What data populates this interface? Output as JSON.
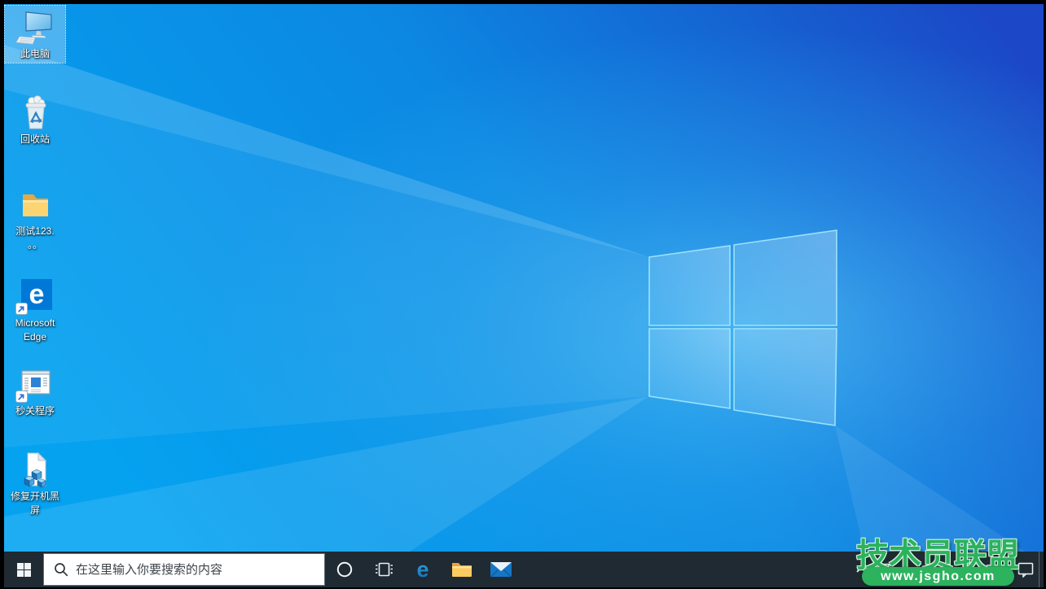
{
  "desktop": {
    "icons": [
      {
        "name": "this-pc",
        "icon": "computer-icon",
        "label": "此电脑",
        "selected": true
      },
      {
        "name": "recycle-bin",
        "icon": "recycle-bin-icon",
        "label": "回收站",
        "selected": false
      },
      {
        "name": "folder-test123",
        "icon": "folder-icon",
        "label": "测试123.",
        "label2": "。。",
        "selected": false
      },
      {
        "name": "microsoft-edge",
        "icon": "edge-tile-icon",
        "label": "Microsoft",
        "label2": "Edge",
        "shortcut": true,
        "selected": false
      },
      {
        "name": "seconds-close-program",
        "icon": "app-window-icon",
        "label": "秒关程序",
        "shortcut": true,
        "selected": false
      },
      {
        "name": "fix-boot-black-screen",
        "icon": "registry-file-icon",
        "label": "修复开机黑",
        "label2": "屏",
        "selected": false
      }
    ]
  },
  "taskbar": {
    "start": {
      "name": "start-button",
      "icon": "windows-logo-icon"
    },
    "search": {
      "placeholder": "在这里输入你要搜索的内容",
      "icon": "search-icon"
    },
    "buttons": [
      {
        "name": "cortana-button",
        "icon": "cortana-circle-icon"
      },
      {
        "name": "task-view-button",
        "icon": "task-view-icon"
      },
      {
        "name": "edge-button",
        "icon": "edge-e-icon"
      },
      {
        "name": "file-explorer-button",
        "icon": "folder-icon"
      },
      {
        "name": "mail-button",
        "icon": "mail-envelope-icon"
      }
    ],
    "tray": [
      {
        "name": "hidden-icons-button",
        "icon": "chevron-up-icon"
      },
      {
        "name": "network-button",
        "icon": "monitor-icon"
      },
      {
        "name": "ime-indicator",
        "icon": "ime-icon"
      },
      {
        "name": "action-center-button",
        "icon": "speech-bubble-icon"
      },
      {
        "name": "show-desktop-button",
        "icon": "separator-line"
      }
    ]
  },
  "watermark": {
    "title": "技术员联盟",
    "url": "www.jsgho.com"
  },
  "colors": {
    "wallpaper_left": "#04a1ef",
    "wallpaper_right": "#1b47c7",
    "taskbar_bg": "#202a33",
    "watermark_green": "#2db25e",
    "edge_blue": "#0078d7",
    "folder_yellow": "#fcd471",
    "search_box_bg": "#ffffff"
  }
}
